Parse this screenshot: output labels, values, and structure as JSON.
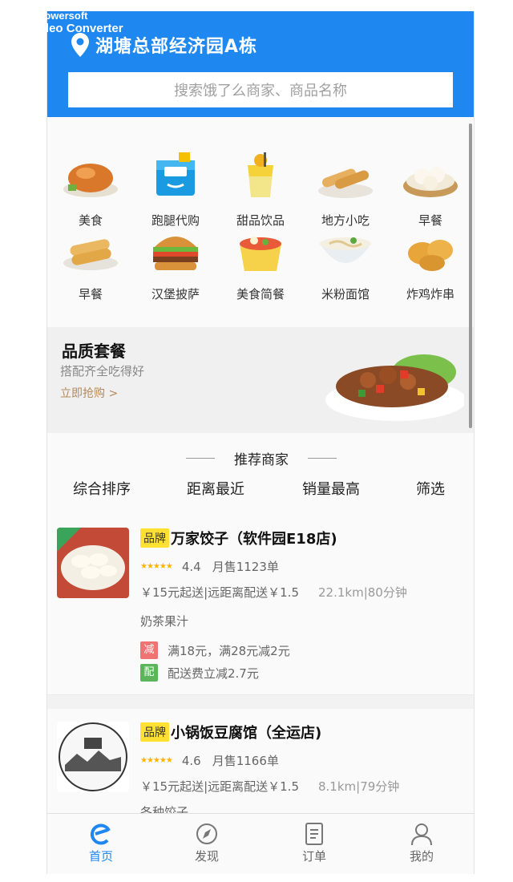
{
  "watermark": {
    "line1": "Apowersoft",
    "line2": "Video Converter"
  },
  "header": {
    "address": "湖塘总部经济园A栋",
    "search_placeholder": "搜索饿了么商家、商品名称",
    "bg_color": "#1e88f0"
  },
  "categories": [
    {
      "label": "美食",
      "icon": "roast-chicken-icon"
    },
    {
      "label": "跑腿代购",
      "icon": "delivery-box-icon"
    },
    {
      "label": "甜品饮品",
      "icon": "drink-cup-icon"
    },
    {
      "label": "地方小吃",
      "icon": "spring-roll-icon"
    },
    {
      "label": "早餐",
      "icon": "dumpling-basket-icon"
    },
    {
      "label": "早餐",
      "icon": "bread-rolls-icon"
    },
    {
      "label": "汉堡披萨",
      "icon": "burger-icon"
    },
    {
      "label": "美食简餐",
      "icon": "lunch-box-icon"
    },
    {
      "label": "米粉面馆",
      "icon": "noodle-bowl-icon"
    },
    {
      "label": "炸鸡炸串",
      "icon": "fried-chicken-icon"
    }
  ],
  "banner": {
    "title": "品质套餐",
    "subtitle": "搭配齐全吃得好",
    "link": "立即抢购 >"
  },
  "recommend": {
    "title": "推荐商家",
    "sorts": [
      "综合排序",
      "距离最近",
      "销量最高",
      "筛选"
    ]
  },
  "shops": [
    {
      "badge": "品牌",
      "name": "万家饺子（软件园E18店)",
      "stars": "★★★★★",
      "score": "4.4",
      "sales": "月售1123单",
      "fee": "￥15元起送|远距离配送￥1.5",
      "distance": "22.1km|80分钟",
      "tags": "奶茶果汁",
      "promos": [
        {
          "icon": "减",
          "text": "满18元，满28元减2元",
          "color": "#f07373"
        },
        {
          "icon": "配",
          "text": "配送费立减2.7元",
          "color": "#5bb55b"
        }
      ],
      "thumb_label": "新店"
    },
    {
      "badge": "品牌",
      "name": "小锅饭豆腐馆（全运店)",
      "stars": "★★★★★",
      "score": "4.6",
      "sales": "月售1166单",
      "fee": "￥15元起送|远距离配送￥1.5",
      "distance": "8.1km|79分钟",
      "tags": "各种饺子"
    }
  ],
  "tabbar": [
    {
      "label": "首页",
      "icon": "home-e-icon",
      "active": true
    },
    {
      "label": "发现",
      "icon": "compass-icon",
      "active": false
    },
    {
      "label": "订单",
      "icon": "order-list-icon",
      "active": false
    },
    {
      "label": "我的",
      "icon": "user-icon",
      "active": false
    }
  ]
}
